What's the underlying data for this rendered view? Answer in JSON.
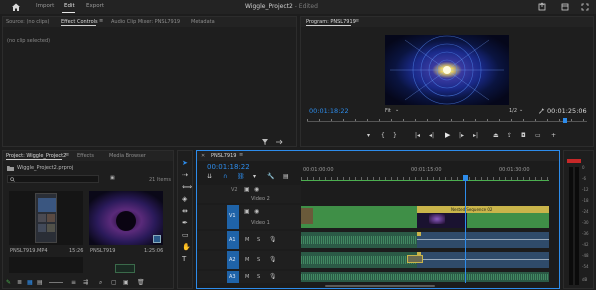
{
  "topbar": {
    "workspaces": [
      "Import",
      "Edit",
      "Export"
    ],
    "title": "Wiggle_Project2",
    "edited": " - Edited"
  },
  "source_panel": {
    "tabs": [
      "Source: (no clips)",
      "Effect Controls",
      "Audio Clip Mixer: PNSL7919",
      "Metadata"
    ],
    "no_clip": "(no clip selected)"
  },
  "program_panel": {
    "tab": "Program: PNSL7919",
    "timecode_left": "00:01:18:22",
    "fit": "Fit",
    "resolution": "1/2",
    "timecode_right": "00:01:25:06"
  },
  "project_panel": {
    "tabs": [
      "Project: Wiggle_Project2",
      "Effects",
      "Media Browser"
    ],
    "file": "Wiggle_Project2.prproj",
    "items_count": "21 Items",
    "clips": [
      {
        "name": "PNSL7919.MP4",
        "duration": "15:26"
      },
      {
        "name": "PNSL7919",
        "duration": "1:25:06"
      }
    ]
  },
  "timeline": {
    "tab": "PNSL7919",
    "timecode": "00:01:18:22",
    "ruler": [
      "00:01:00:00",
      "00:01:15:00",
      "00:01:30:00"
    ],
    "video_tracks": [
      {
        "id": "V2",
        "name": "Video 2"
      },
      {
        "id": "V1",
        "name": "Video 1"
      }
    ],
    "audio_tracks": [
      "A1",
      "A2",
      "A3"
    ],
    "nested_label": "Nested Sequence 02",
    "track_letters": {
      "mute": "M",
      "solo": "S"
    }
  },
  "meter_scale": [
    "0",
    "-6",
    "-12",
    "-18",
    "-24",
    "-30",
    "-36",
    "-42",
    "-48",
    "-54",
    "dB"
  ],
  "colors": {
    "accent_blue": "#2d8ceb",
    "clip_green": "#3f8f47",
    "audio_green": "#2b5a46",
    "audio_blue": "#2f4b6a",
    "nested_yellow": "#c9b44a"
  }
}
